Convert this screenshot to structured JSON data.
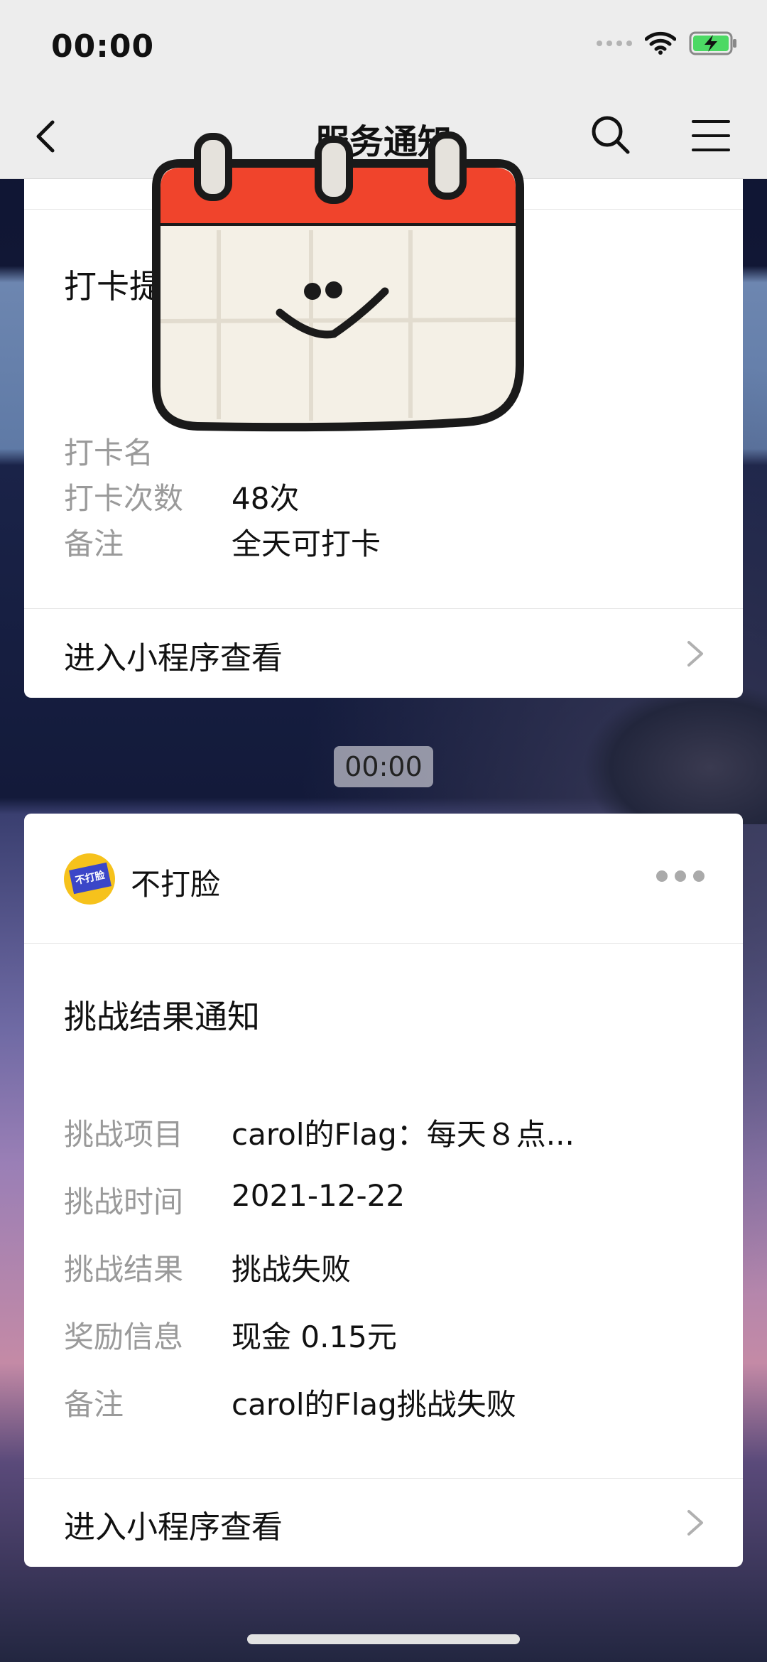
{
  "status_bar": {
    "time": "00:00"
  },
  "nav": {
    "title": "服务通知"
  },
  "card1": {
    "title": "打卡提",
    "rows": [
      {
        "key": "打卡名",
        "value": ""
      },
      {
        "key": "打卡次数",
        "value": "48次"
      },
      {
        "key": "备注",
        "value": "全天可打卡"
      }
    ],
    "enter_label": "进入小程序查看"
  },
  "time_divider": "00:00",
  "card2": {
    "sender": {
      "name": "不打脸",
      "avatar_text": "不打脸"
    },
    "title": "挑战结果通知",
    "rows": [
      {
        "key": "挑战项目",
        "value": "carol的Flag：每天８点..."
      },
      {
        "key": "挑战时间",
        "value": "2021-12-22"
      },
      {
        "key": "挑战结果",
        "value": "挑战失败"
      },
      {
        "key": "奖励信息",
        "value": "现金 0.15元"
      },
      {
        "key": "备注",
        "value": "carol的Flag挑战失败"
      }
    ],
    "enter_label": "进入小程序查看"
  },
  "colors": {
    "calendar_header": "#f0442c",
    "avatar_bg": "#f6c21c",
    "flag": "#3b46c8"
  },
  "icons": [
    "back-arrow-icon",
    "search-icon",
    "menu-icon",
    "wifi-icon",
    "battery-charging-icon",
    "chevron-right-icon",
    "more-dots-icon",
    "calendar-sticker"
  ]
}
